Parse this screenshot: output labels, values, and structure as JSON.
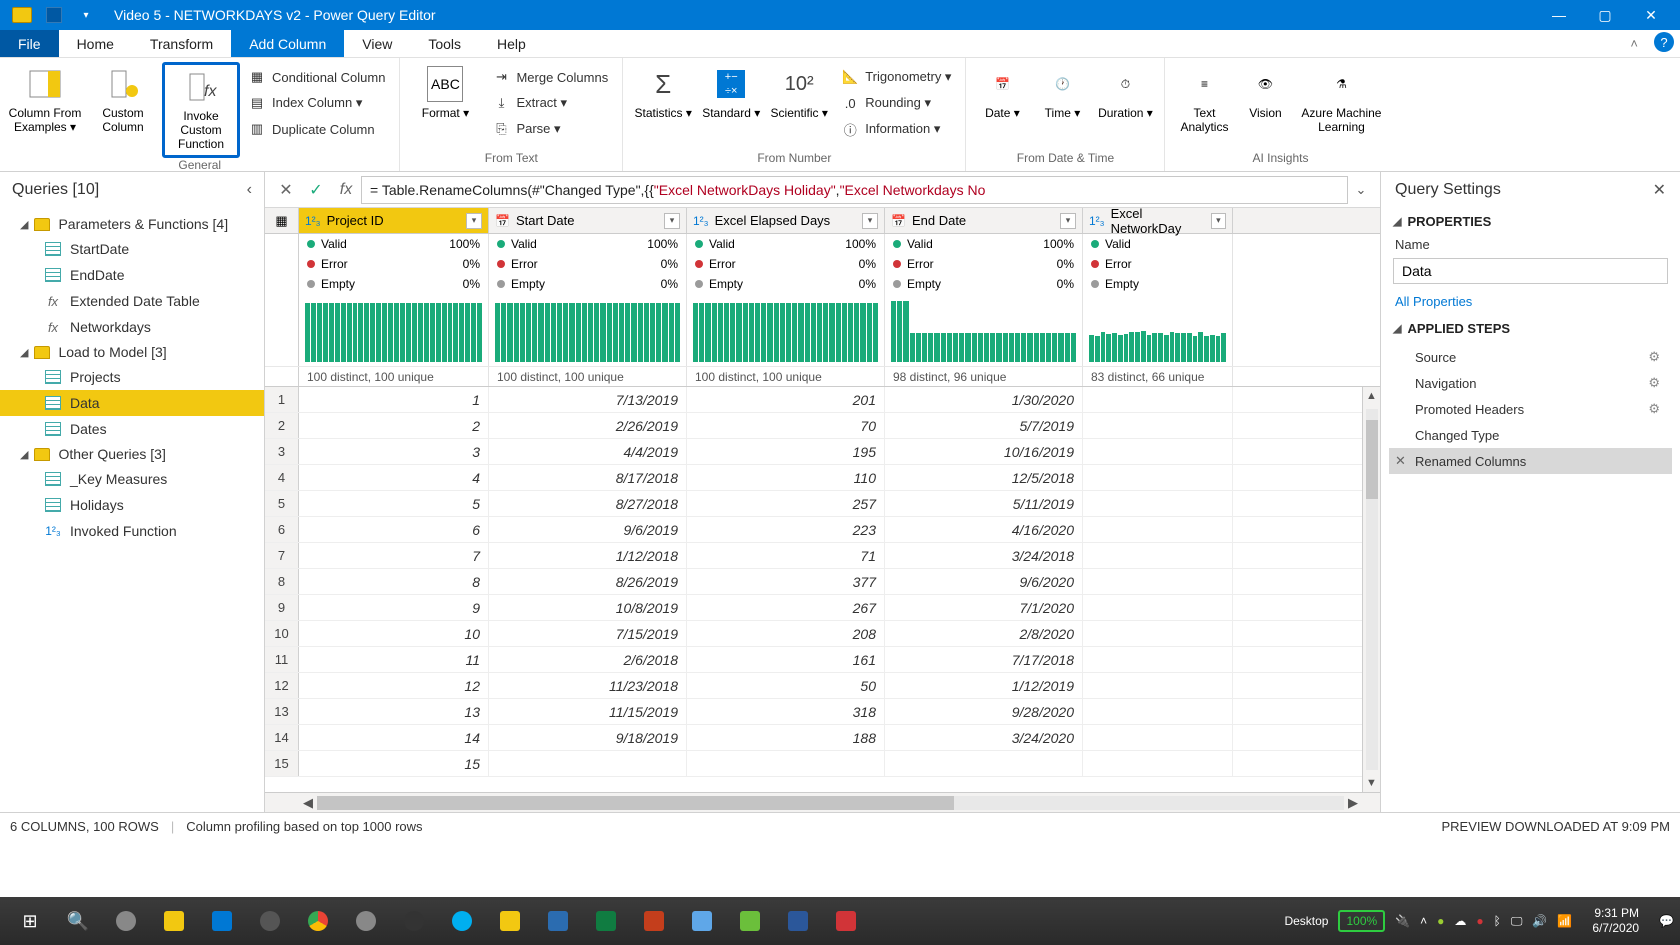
{
  "titlebar": {
    "title": "Video 5 - NETWORKDAYS v2 - Power Query Editor"
  },
  "tabs": {
    "file": "File",
    "home": "Home",
    "transform": "Transform",
    "add_column": "Add Column",
    "view": "View",
    "tools": "Tools",
    "help": "Help"
  },
  "ribbon": {
    "general": {
      "label": "General",
      "col_examples": "Column From Examples ▾",
      "custom_col": "Custom Column",
      "invoke_fn": "Invoke Custom Function",
      "cond_col": "Conditional Column",
      "index_col": "Index Column ▾",
      "dup_col": "Duplicate Column"
    },
    "from_text": {
      "label": "From Text",
      "format": "Format ▾",
      "merge": "Merge Columns",
      "extract": "Extract ▾",
      "parse": "Parse ▾"
    },
    "from_number": {
      "label": "From Number",
      "stats": "Statistics ▾",
      "standard": "Standard ▾",
      "scientific": "Scientific ▾",
      "trig": "Trigonometry ▾",
      "round": "Rounding ▾",
      "info": "Information ▾"
    },
    "from_datetime": {
      "label": "From Date & Time",
      "date": "Date ▾",
      "time": "Time ▾",
      "duration": "Duration ▾"
    },
    "ai": {
      "label": "AI Insights",
      "text": "Text Analytics",
      "vision": "Vision",
      "aml": "Azure Machine Learning"
    }
  },
  "queries_pane": {
    "title": "Queries [10]",
    "groups": [
      {
        "label": "Parameters & Functions [4]",
        "items": [
          {
            "label": "StartDate",
            "icon": "table"
          },
          {
            "label": "EndDate",
            "icon": "table"
          },
          {
            "label": "Extended Date Table",
            "icon": "fx"
          },
          {
            "label": "Networkdays",
            "icon": "fx"
          }
        ]
      },
      {
        "label": "Load to Model [3]",
        "items": [
          {
            "label": "Projects",
            "icon": "table"
          },
          {
            "label": "Data",
            "icon": "table",
            "selected": true
          },
          {
            "label": "Dates",
            "icon": "table"
          }
        ]
      },
      {
        "label": "Other Queries [3]",
        "items": [
          {
            "label": "_Key Measures",
            "icon": "table"
          },
          {
            "label": "Holidays",
            "icon": "table"
          },
          {
            "label": "Invoked Function",
            "icon": "num"
          }
        ]
      }
    ]
  },
  "formula": {
    "prefix": "= Table.RenameColumns(#\"Changed Type\",{{",
    "str1": "\"Excel NetworkDays  Holiday\"",
    "mid": ", ",
    "str2": "\"Excel Networkdays No"
  },
  "columns": [
    {
      "name": "Project ID",
      "type": "1²₃",
      "distinct": "100 distinct, 100 unique",
      "selected": true
    },
    {
      "name": "Start Date",
      "type": "📅",
      "distinct": "100 distinct, 100 unique"
    },
    {
      "name": "Excel Elapsed Days",
      "type": "1²₃",
      "distinct": "100 distinct, 100 unique"
    },
    {
      "name": "End Date",
      "type": "📅",
      "distinct": "98 distinct, 96 unique"
    },
    {
      "name": "Excel NetworkDay",
      "type": "1²₃",
      "distinct": "83 distinct, 66 unique"
    }
  ],
  "profile": {
    "valid": {
      "label": "Valid",
      "pcts": [
        "100%",
        "100%",
        "100%",
        "100%",
        ""
      ]
    },
    "error": {
      "label": "Error",
      "pcts": [
        "0%",
        "0%",
        "0%",
        "0%",
        ""
      ]
    },
    "empty": {
      "label": "Empty",
      "pcts": [
        "0%",
        "0%",
        "0%",
        "0%",
        ""
      ]
    }
  },
  "rows": [
    {
      "id": 1,
      "start": "7/13/2019",
      "days": 201,
      "end": "1/30/2020"
    },
    {
      "id": 2,
      "start": "2/26/2019",
      "days": 70,
      "end": "5/7/2019"
    },
    {
      "id": 3,
      "start": "4/4/2019",
      "days": 195,
      "end": "10/16/2019"
    },
    {
      "id": 4,
      "start": "8/17/2018",
      "days": 110,
      "end": "12/5/2018"
    },
    {
      "id": 5,
      "start": "8/27/2018",
      "days": 257,
      "end": "5/11/2019"
    },
    {
      "id": 6,
      "start": "9/6/2019",
      "days": 223,
      "end": "4/16/2020"
    },
    {
      "id": 7,
      "start": "1/12/2018",
      "days": 71,
      "end": "3/24/2018"
    },
    {
      "id": 8,
      "start": "8/26/2019",
      "days": 377,
      "end": "9/6/2020"
    },
    {
      "id": 9,
      "start": "10/8/2019",
      "days": 267,
      "end": "7/1/2020"
    },
    {
      "id": 10,
      "start": "7/15/2019",
      "days": 208,
      "end": "2/8/2020"
    },
    {
      "id": 11,
      "start": "2/6/2018",
      "days": 161,
      "end": "7/17/2018"
    },
    {
      "id": 12,
      "start": "11/23/2018",
      "days": 50,
      "end": "1/12/2019"
    },
    {
      "id": 13,
      "start": "11/15/2019",
      "days": 318,
      "end": "9/28/2020"
    },
    {
      "id": 14,
      "start": "9/18/2019",
      "days": 188,
      "end": "3/24/2020"
    },
    {
      "id": 15,
      "start": "",
      "days": "",
      "end": ""
    }
  ],
  "settings": {
    "title": "Query Settings",
    "properties": "PROPERTIES",
    "name_label": "Name",
    "name_value": "Data",
    "all_props": "All Properties",
    "steps_label": "APPLIED STEPS",
    "steps": [
      {
        "label": "Source",
        "gear": true
      },
      {
        "label": "Navigation",
        "gear": true
      },
      {
        "label": "Promoted Headers",
        "gear": true
      },
      {
        "label": "Changed Type"
      },
      {
        "label": "Renamed Columns",
        "selected": true
      }
    ]
  },
  "status": {
    "left1": "6 COLUMNS, 100 ROWS",
    "left2": "Column profiling based on top 1000 rows",
    "right": "PREVIEW DOWNLOADED AT 9:09 PM"
  },
  "taskbar": {
    "desktop": "Desktop",
    "battery": "100%",
    "time": "9:31 PM",
    "date": "6/7/2020"
  }
}
